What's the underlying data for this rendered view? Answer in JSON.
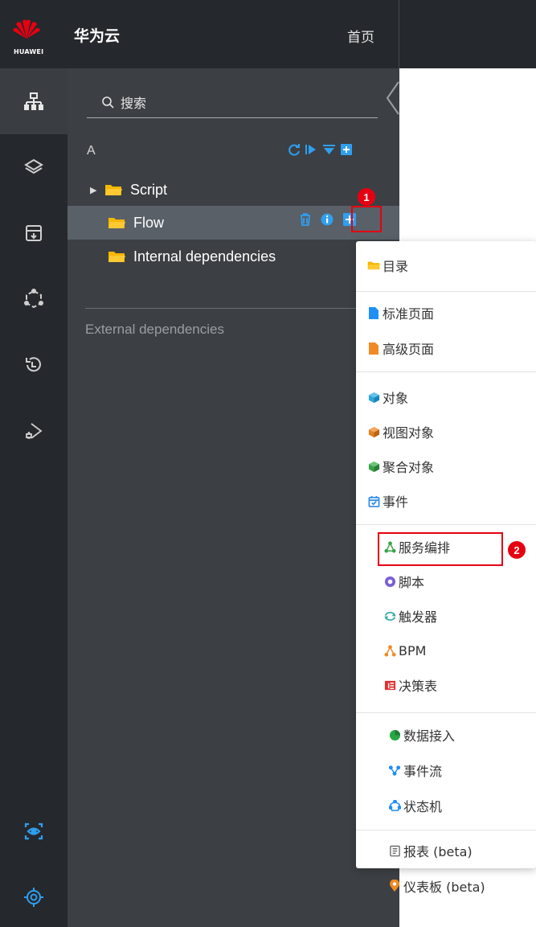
{
  "header": {
    "logo_text": "HUAWEI",
    "brand": "华为云",
    "home": "首页"
  },
  "rail": {
    "items": [
      {
        "name": "tree-icon",
        "active": true
      },
      {
        "name": "layers-icon"
      },
      {
        "name": "archive-icon"
      },
      {
        "name": "hexagon-icon"
      },
      {
        "name": "history-icon"
      },
      {
        "name": "debug-icon"
      },
      {
        "name": "eye-scan-icon"
      },
      {
        "name": "target-icon"
      }
    ]
  },
  "panel": {
    "search_placeholder": "搜索",
    "project": "A",
    "tree": [
      {
        "label": "Script",
        "has_caret": true
      },
      {
        "label": "Flow",
        "selected": true
      },
      {
        "label": "Internal dependencies"
      }
    ],
    "external": "External dependencies"
  },
  "callouts": [
    "1",
    "2"
  ],
  "menu": {
    "groups": [
      [
        {
          "label": "目录",
          "icon": "folder-icon",
          "color": "#f5b800"
        }
      ],
      [
        {
          "label": "标准页面",
          "icon": "page-icon",
          "color": "#1f8ff5"
        },
        {
          "label": "高级页面",
          "icon": "page-icon",
          "color": "#f08a24"
        }
      ],
      [
        {
          "label": "对象",
          "icon": "cube-icon",
          "color": "#2ea6d9"
        },
        {
          "label": "视图对象",
          "icon": "cube-icon",
          "color": "#e0821f"
        },
        {
          "label": "聚合对象",
          "icon": "cube-icon",
          "color": "#3aa34a"
        },
        {
          "label": "事件",
          "icon": "calendar-icon",
          "color": "#2f8be8"
        }
      ],
      [
        {
          "label": "服务编排",
          "icon": "flow-icon",
          "color": "#3aa34a"
        },
        {
          "label": "脚本",
          "icon": "script-icon",
          "color": "#7a5fd6"
        },
        {
          "label": "触发器",
          "icon": "trigger-icon",
          "color": "#2ea6a0"
        },
        {
          "label": "BPM",
          "icon": "bpm-icon",
          "color": "#f08a24"
        },
        {
          "label": "决策表",
          "icon": "table-icon",
          "color": "#e03030"
        }
      ],
      [
        {
          "label": "数据接入",
          "icon": "pie-icon",
          "color": "#27a844"
        },
        {
          "label": "事件流",
          "icon": "stream-icon",
          "color": "#1f8ff5"
        },
        {
          "label": "状态机",
          "icon": "state-icon",
          "color": "#1f8ff5"
        }
      ],
      [
        {
          "label": "报表 (beta)",
          "icon": "report-icon",
          "color": "#666666"
        },
        {
          "label": "仪表板 (beta)",
          "icon": "pin-icon",
          "color": "#f08a24"
        }
      ]
    ]
  }
}
